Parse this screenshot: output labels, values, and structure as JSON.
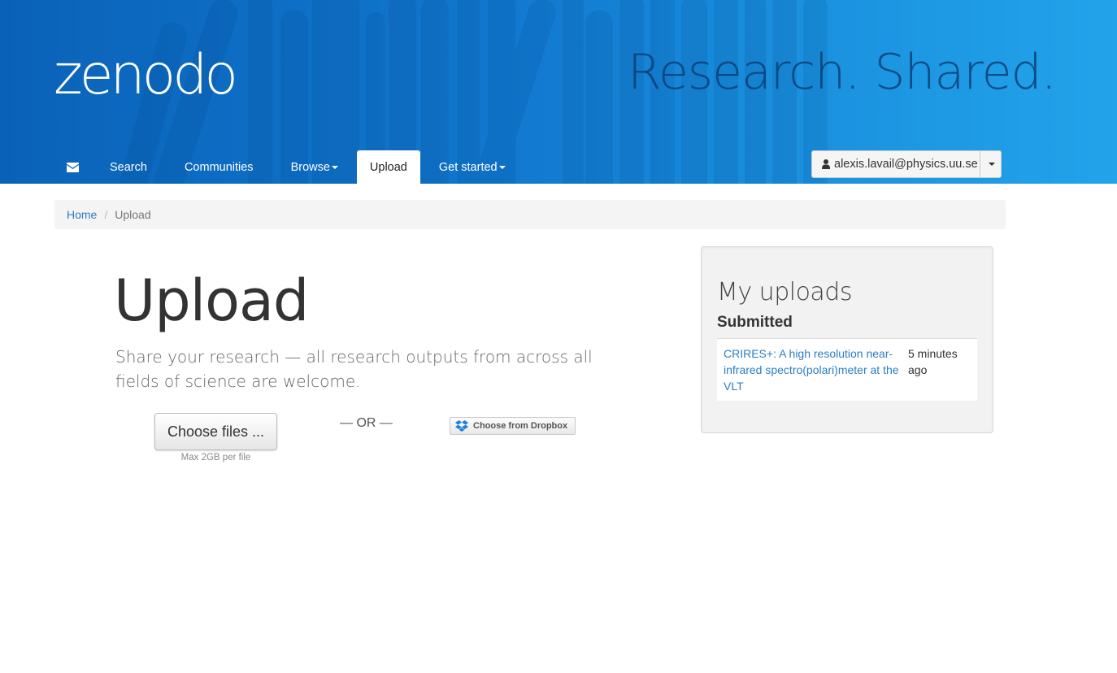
{
  "brand": {
    "logo_text": "zenodo",
    "tagline": "Research. Shared."
  },
  "nav": {
    "items": [
      {
        "label": "",
        "icon": "envelope-icon"
      },
      {
        "label": "Search"
      },
      {
        "label": "Communities"
      },
      {
        "label": "Browse",
        "dropdown": true
      },
      {
        "label": "Upload",
        "active": true
      },
      {
        "label": "Get started",
        "dropdown": true
      }
    ]
  },
  "user": {
    "email": "alexis.lavail@physics.uu.se",
    "icon": "user-icon"
  },
  "breadcrumb": {
    "home": "Home",
    "current": "Upload"
  },
  "main": {
    "title": "Upload",
    "lead": "Share your research — all research outputs from across all fields of science are welcome.",
    "choose_files_label": "Choose files ...",
    "max_note": "Max 2GB per file",
    "or_label": "— OR —",
    "dropbox_label": "Choose from Dropbox"
  },
  "sidebar": {
    "title": "My uploads",
    "subtitle": "Submitted",
    "uploads": [
      {
        "title": "CRIRES+: A high resolution near-infrared spectro(polari)meter at the VLT",
        "time": "5 minutes ago"
      }
    ]
  },
  "colors": {
    "header_start": "#0a62b8",
    "header_end": "#22a3ea",
    "link": "#2a7ec4",
    "tagline": "#0b3f75"
  }
}
